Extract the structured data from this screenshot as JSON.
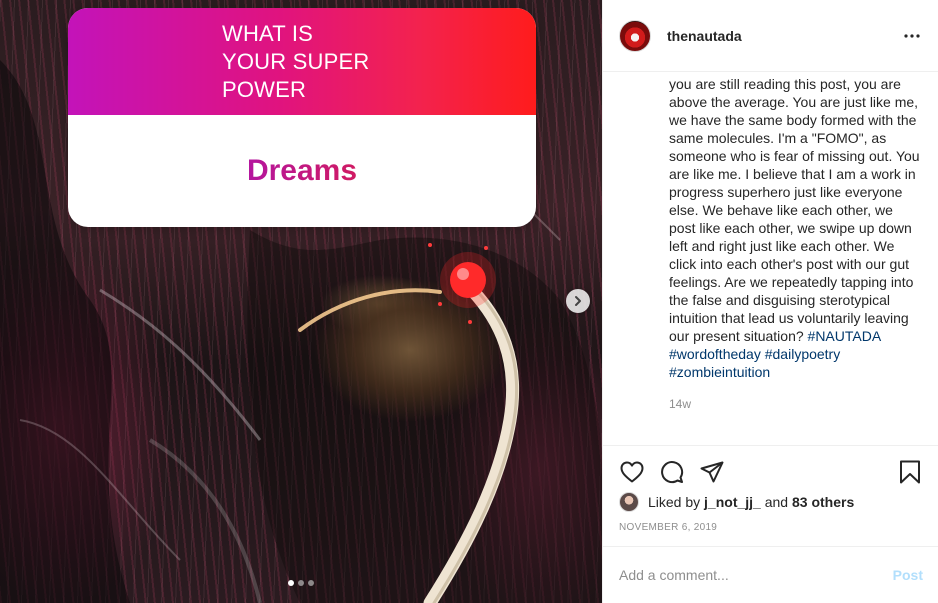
{
  "media": {
    "story_question": "WHAT IS YOUR SUPER POWER",
    "story_answer": "Dreams",
    "carousel_total": 3,
    "carousel_active": 1,
    "next_icon": "chevron-right-icon"
  },
  "post": {
    "username": "thenautada",
    "avatar_icon": "profile-avatar",
    "more_icon": "more-horizontal-icon",
    "caption_text": "you are still reading this post, you are above the average. You are just like me, we have the same body formed with the same molecules. I'm a \"FOMO\", as someone who is fear of missing out. You are like me. I believe that I am a work in progress superhero just like everyone else. We behave like each other, we post like each other, we swipe up down left and right just like each other. We click into each other's post with our gut feelings. Are we repeatedly tapping into the false and disguising sterotypical intuition that lead us voluntarily leaving our present situation?",
    "hashtags": [
      "#NAUTADA",
      "#wordoftheday",
      "#dailypoetry",
      "#zombieintuition"
    ],
    "time_ago": "14w",
    "actions": {
      "like_icon": "heart-icon",
      "comment_icon": "comment-icon",
      "share_icon": "share-icon",
      "save_icon": "bookmark-icon"
    },
    "likes": {
      "prefix": "Liked by",
      "user": "j_not_jj_",
      "connector": "and",
      "others": "83 others"
    },
    "date": "NOVEMBER 6, 2019",
    "comment_placeholder": "Add a comment...",
    "post_label": "Post",
    "post_button_color": "#b2dffc",
    "hashtag_color": "#00376b"
  }
}
